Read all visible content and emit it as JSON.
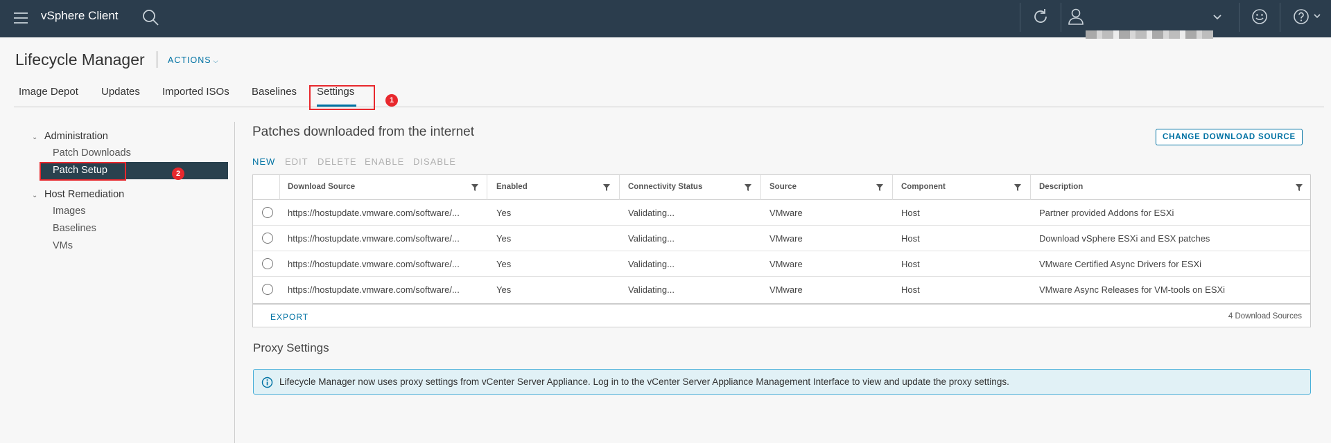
{
  "header": {
    "app_title": "vSphere Client",
    "icons": [
      "menu-icon",
      "search-icon",
      "refresh-icon",
      "user-icon",
      "chevron-down-icon",
      "smile-icon",
      "help-icon"
    ]
  },
  "page": {
    "title": "Lifecycle Manager",
    "actions_label": "ACTIONS"
  },
  "tabs": [
    {
      "label": "Image Depot"
    },
    {
      "label": "Updates"
    },
    {
      "label": "Imported ISOs"
    },
    {
      "label": "Baselines"
    },
    {
      "label": "Settings",
      "active": true
    }
  ],
  "annotations": {
    "step1": "1",
    "step2": "2",
    "highlight_color": "#e8282d"
  },
  "sidebar": {
    "groups": [
      {
        "label": "Administration",
        "items": [
          {
            "label": "Patch Downloads"
          },
          {
            "label": "Patch Setup",
            "selected": true
          }
        ]
      },
      {
        "label": "Host Remediation",
        "items": [
          {
            "label": "Images"
          },
          {
            "label": "Baselines"
          },
          {
            "label": "VMs"
          }
        ]
      }
    ]
  },
  "main": {
    "section_title": "Patches downloaded from the internet",
    "change_source_label": "CHANGE DOWNLOAD SOURCE",
    "toolbar": {
      "new": "NEW",
      "edit": "EDIT",
      "delete": "DELETE",
      "enable": "ENABLE",
      "disable": "DISABLE"
    },
    "table": {
      "columns": [
        "Download Source",
        "Enabled",
        "Connectivity Status",
        "Source",
        "Component",
        "Description"
      ],
      "rows": [
        [
          "https://hostupdate.vmware.com/software/...",
          "Yes",
          "Validating...",
          "VMware",
          "Host",
          "Partner provided Addons for ESXi"
        ],
        [
          "https://hostupdate.vmware.com/software/...",
          "Yes",
          "Validating...",
          "VMware",
          "Host",
          "Download vSphere ESXi and ESX patches"
        ],
        [
          "https://hostupdate.vmware.com/software/...",
          "Yes",
          "Validating...",
          "VMware",
          "Host",
          "VMware Certified Async Drivers for ESXi"
        ],
        [
          "https://hostupdate.vmware.com/software/...",
          "Yes",
          "Validating...",
          "VMware",
          "Host",
          "VMware Async Releases for VM-tools on ESXi"
        ]
      ],
      "export_label": "EXPORT",
      "footer_count": "4 Download Sources"
    },
    "proxy": {
      "title": "Proxy Settings",
      "info_text": "Lifecycle Manager now uses proxy settings from vCenter Server Appliance. Log in to the vCenter Server Appliance Management Interface to view and update the proxy settings."
    }
  },
  "colors": {
    "header_bg": "#2b3d4d",
    "accent": "#0072a3",
    "selected_nav_bg": "#29414e",
    "info_bg": "#e1f1f6"
  }
}
